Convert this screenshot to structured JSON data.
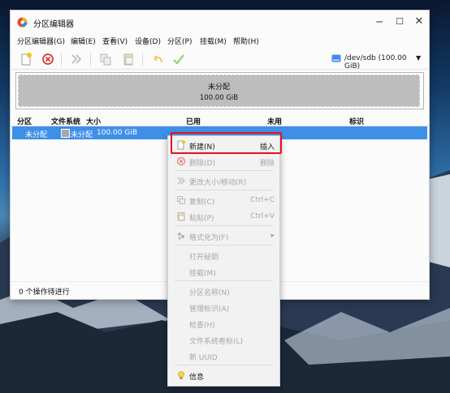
{
  "window": {
    "title": "分区编辑器"
  },
  "menubar": [
    "分区编辑器(G)",
    "编辑(E)",
    "查看(V)",
    "设备(D)",
    "分区(P)",
    "挂载(M)",
    "帮助(H)"
  ],
  "toolbar": {
    "icons": [
      "new-icon",
      "delete-icon",
      "resize-move-icon",
      "copy-icon",
      "paste-icon",
      "undo-icon",
      "apply-icon"
    ],
    "device": "/dev/sdb (100.00 GiB)"
  },
  "graphic": {
    "name": "未分配",
    "size": "100.00 GiB"
  },
  "table": {
    "headers": [
      "分区",
      "文件系统",
      "大小",
      "已用",
      "未用",
      "标识"
    ],
    "rows": [
      {
        "partition": "未分配",
        "filesystem": "未分配",
        "size": "100.00 GiB",
        "used": "",
        "unused": "",
        "flags": ""
      }
    ]
  },
  "status": {
    "text": "0 个操作待进行"
  },
  "context_menu": {
    "items": [
      {
        "label": "新建(N)",
        "shortcut": "插入",
        "enabled": true,
        "icon": "new-icon"
      },
      {
        "label": "删除(D)",
        "shortcut": "删除",
        "enabled": false,
        "icon": "delete-icon"
      },
      {
        "label": "更改大小/移动(R)",
        "shortcut": "",
        "enabled": false,
        "icon": "resize-move-icon"
      },
      {
        "label": "复制(C)",
        "shortcut": "Ctrl+C",
        "enabled": false,
        "icon": "copy-icon"
      },
      {
        "label": "粘贴(P)",
        "shortcut": "Ctrl+V",
        "enabled": false,
        "icon": "paste-icon"
      },
      {
        "label": "格式化为(F)",
        "shortcut": "",
        "enabled": false,
        "icon": "format-icon"
      },
      {
        "label": "打开秘钥",
        "shortcut": "",
        "enabled": false,
        "icon": ""
      },
      {
        "label": "挂载(M)",
        "shortcut": "",
        "enabled": false,
        "icon": ""
      },
      {
        "label": "分区名称(N)",
        "shortcut": "",
        "enabled": false,
        "icon": ""
      },
      {
        "label": "管理标识(A)",
        "shortcut": "",
        "enabled": false,
        "icon": ""
      },
      {
        "label": "检查(H)",
        "shortcut": "",
        "enabled": false,
        "icon": ""
      },
      {
        "label": "文件系统卷标(L)",
        "shortcut": "",
        "enabled": false,
        "icon": ""
      },
      {
        "label": "新 UUID",
        "shortcut": "",
        "enabled": false,
        "icon": ""
      },
      {
        "label": "信息",
        "shortcut": "",
        "enabled": true,
        "icon": "info-icon"
      }
    ]
  },
  "colors": {
    "selection": "#3e8fe8",
    "highlight_box": "#e2131c",
    "unallocated": "#bdbdbd"
  }
}
